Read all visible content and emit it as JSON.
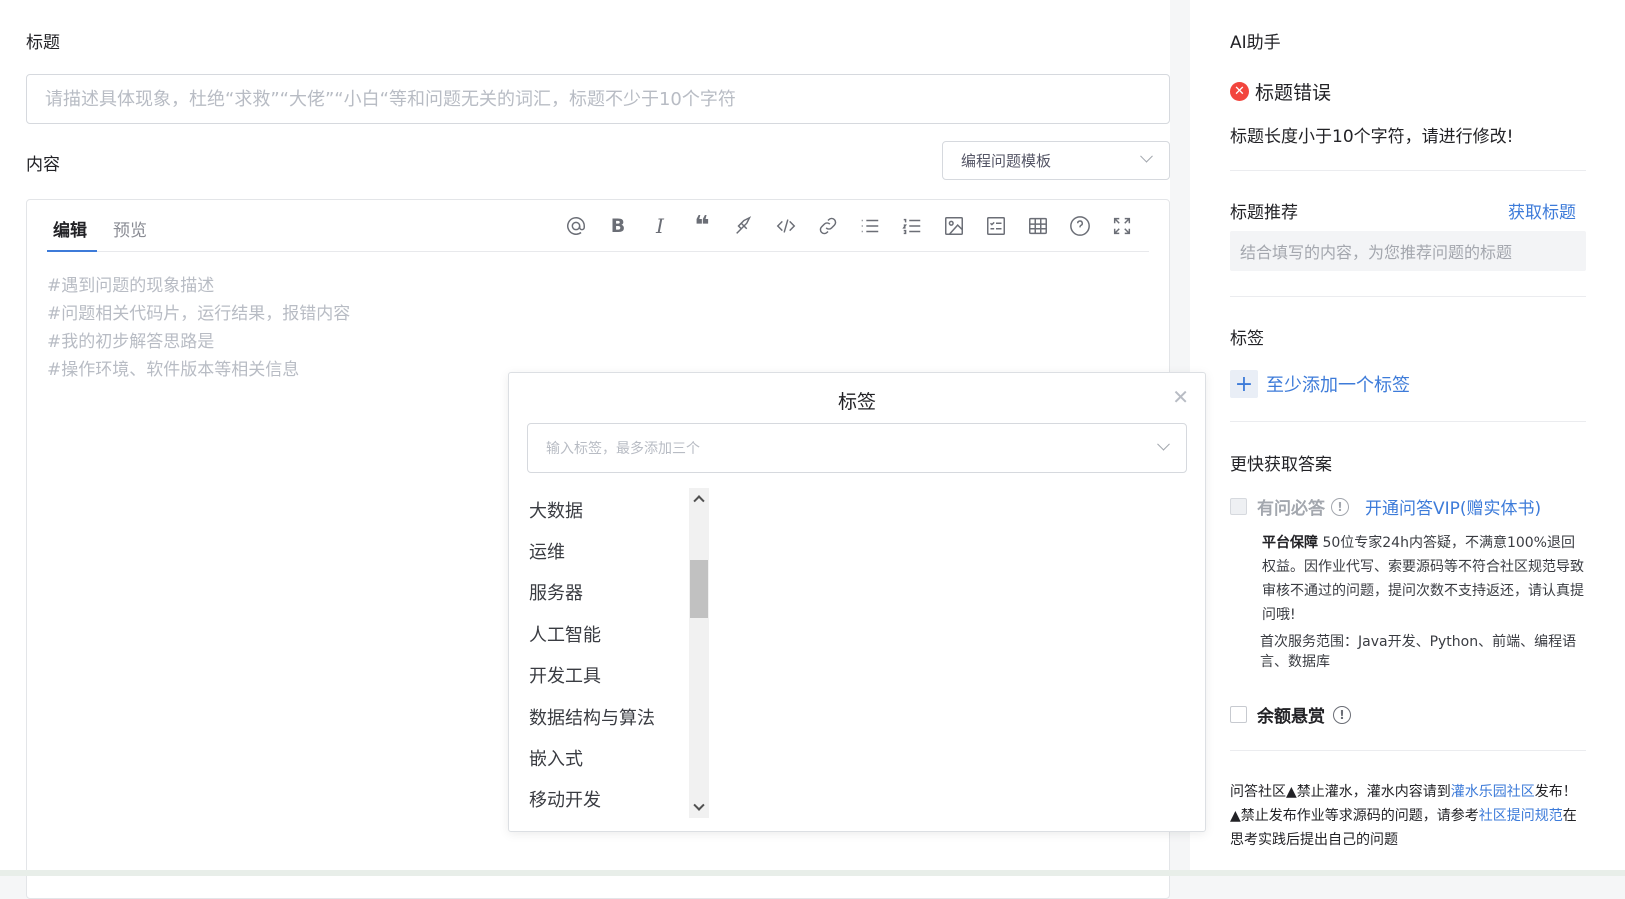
{
  "main": {
    "title_label": "标题",
    "title_placeholder": "请描述具体现象，杜绝“求救”“大佬”“小白“等和问题无关的词汇，标题不少于10个字符",
    "content_label": "内容",
    "template_select": "编程问题模板",
    "editor": {
      "tabs": [
        {
          "label": "编辑",
          "active": true
        },
        {
          "label": "预览",
          "active": false
        }
      ],
      "toolbar": [
        "at-icon",
        "bold-icon",
        "italic-icon",
        "quote-icon",
        "brush-icon",
        "code-icon",
        "link-icon",
        "bullet-list-icon",
        "ordered-list-icon",
        "image-icon",
        "checklist-icon",
        "table-icon",
        "help-icon",
        "fullscreen-icon"
      ],
      "placeholder_lines": [
        "#遇到问题的现象描述",
        "#问题相关代码片，运行结果，报错内容",
        "#我的初步解答思路是",
        "#操作环境、软件版本等相关信息"
      ]
    }
  },
  "side": {
    "ai_heading": "AI助手",
    "error_title": "标题错误",
    "error_msg": "标题长度小于10个字符，请进行修改!",
    "recommend_label": "标题推荐",
    "get_title_link": "获取标题",
    "recommend_placeholder": "结合填写的内容，为您推荐问题的标题",
    "tags_label": "标签",
    "add_tag": "至少添加一个标签",
    "faster_heading": "更快获取答案",
    "must_answer_label": "有问必答",
    "vip_link": "开通问答VIP(赠实体书)",
    "guarantee_bold": "平台保障",
    "guarantee_text": " 50位专家24h内答疑，不满意100%退回权益。因作业代写、索要源码等不符合社区规范导致审核不通过的问题，提问次数不支持返还，请认真提问哦!",
    "scope_text": "首次服务范围：Java开发、Python、前端、编程语言、数据库",
    "bounty_label": "余额悬赏",
    "rules": {
      "p1": "问答社区▲禁止灌水，灌水内容请到",
      "link1": "灌水乐园社区",
      "p2": "发布！▲禁止发布作业等求源码的问题，请参考",
      "link2": "社区提问规范",
      "p3": "在思考实践后提出自己的问题"
    }
  },
  "dialog": {
    "title": "标签",
    "input_placeholder": "输入标签，最多添加三个",
    "tags": [
      "大数据",
      "运维",
      "服务器",
      "人工智能",
      "开发工具",
      "数据结构与算法",
      "嵌入式",
      "移动开发"
    ]
  },
  "colors": {
    "accent": "#3d7bd9",
    "error": "#f2453d"
  }
}
